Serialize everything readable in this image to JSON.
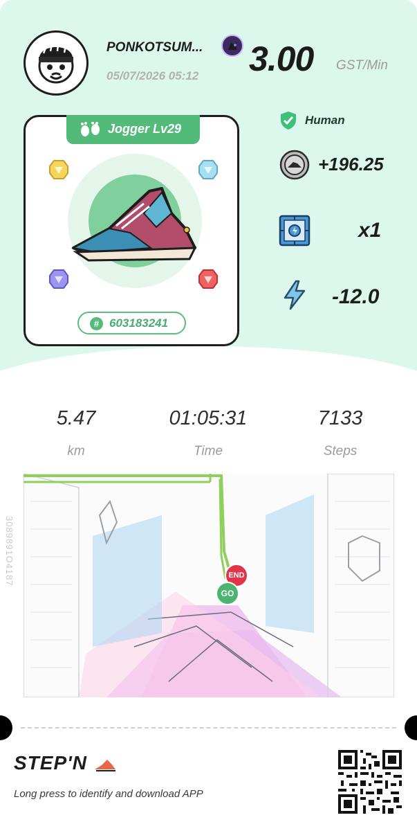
{
  "profile": {
    "name": "PONKOTSUM...",
    "date": "05/07/2026 05:12",
    "avatar_icon": "cartoon-avatar-icon",
    "badge_icon": "profile-badge-icon"
  },
  "earnings": {
    "value": "3.00",
    "unit": "GST/Min"
  },
  "sneaker": {
    "level_label": "Jogger Lv29",
    "id_label": "603183241",
    "image_icon": "sneaker-image",
    "gems": [
      "gem-yellow-icon",
      "gem-blue-icon",
      "gem-purple-icon",
      "gem-red-icon"
    ]
  },
  "stats": {
    "human_label": "Human",
    "score": "+196.25",
    "multiplier": "x1",
    "energy": "-12.0"
  },
  "metrics": [
    {
      "value": "5.47",
      "label": "km"
    },
    {
      "value": "01:05:31",
      "label": "Time"
    },
    {
      "value": "7133",
      "label": "Steps"
    }
  ],
  "map": {
    "end_label": "END",
    "go_label": "GO",
    "watermark": "3089891O4187"
  },
  "footer": {
    "logo_text": "STEP'N",
    "hint": "Long press to identify and download APP",
    "qr_icon": "qr-code-icon"
  },
  "colors": {
    "accent_green": "#52bb7a",
    "background_mint": "#dcf7ec",
    "end_red": "#e3344a"
  }
}
